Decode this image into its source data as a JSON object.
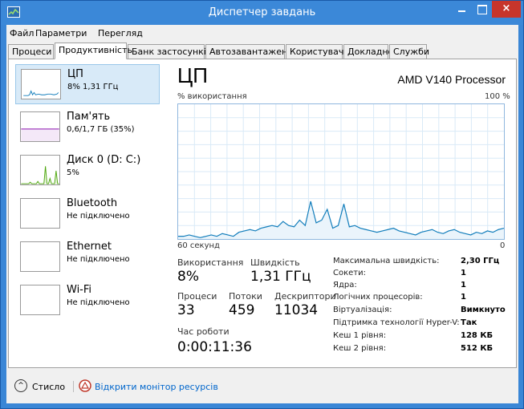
{
  "window": {
    "title": "Диспетчер завдань",
    "close_glyph": "×"
  },
  "menu": [
    "Файл",
    "Параметри",
    "Перегляд"
  ],
  "tabs": [
    "Процеси",
    "Продуктивність",
    "Банк застосунків",
    "Автозавантаження",
    "Користувачі",
    "Докладно",
    "Служби"
  ],
  "active_tab": "Продуктивність",
  "sidebar": [
    {
      "title": "ЦП",
      "sub": "8% 1,31 ГГц"
    },
    {
      "title": "Пам'ять",
      "sub": "0,6/1,7 ГБ (35%)"
    },
    {
      "title": "Диск 0 (D: C:)",
      "sub": "5%"
    },
    {
      "title": "Bluetooth",
      "sub": "Не підключено"
    },
    {
      "title": "Ethernet",
      "sub": "Не підключено"
    },
    {
      "title": "Wi-Fi",
      "sub": "Не підключено"
    }
  ],
  "main": {
    "title": "ЦП",
    "processor": "AMD V140 Processor",
    "usage_label": "% використання",
    "usage_max": "100 %",
    "time_left": "60 секунд",
    "time_right": "0"
  },
  "stats": {
    "usage_label": "Використання",
    "usage_value": "8%",
    "speed_label": "Швидкість",
    "speed_value": "1,31 ГГц",
    "processes_label": "Процеси",
    "processes_value": "33",
    "threads_label": "Потоки",
    "threads_value": "459",
    "handles_label": "Дескриптори",
    "handles_value": "11034",
    "uptime_label": "Час роботи",
    "uptime_value": "0:00:11:36"
  },
  "details": [
    {
      "key": "Максимальна швидкість:",
      "value": "2,30 ГГц"
    },
    {
      "key": "Сокети:",
      "value": "1"
    },
    {
      "key": "Ядра:",
      "value": "1"
    },
    {
      "key": "Логічних процесорів:",
      "value": "1"
    },
    {
      "key": "Віртуалізація:",
      "value": "Вимкнуто"
    },
    {
      "key": "Підтримка технології Hyper-V:",
      "value": "Так"
    },
    {
      "key": "Кеш 1 рівня:",
      "value": "128 КБ"
    },
    {
      "key": "Кеш 2 рівня:",
      "value": "512 КБ"
    }
  ],
  "footer": {
    "less_label": "Стисло",
    "monitor_label": "Відкрити монітор ресурсів"
  },
  "colors": {
    "titlebar": "#3b88d8",
    "graph_line": "#117dbb",
    "graph_fill": "#eaf4fb",
    "memory_line": "#8b12ae",
    "disk_line": "#4da60c"
  },
  "cpu_graph_points": [
    2,
    2,
    3,
    2,
    1,
    2,
    3,
    2,
    4,
    3,
    2,
    5,
    6,
    7,
    6,
    8,
    9,
    10,
    9,
    13,
    10,
    9,
    14,
    10,
    28,
    12,
    14,
    22,
    8,
    10,
    26,
    9,
    10,
    8,
    7,
    6,
    5,
    6,
    7,
    8,
    6,
    5,
    4,
    3,
    5,
    6,
    7,
    5,
    4,
    6,
    7,
    5,
    4,
    3,
    5,
    4,
    6,
    5,
    7,
    8
  ]
}
